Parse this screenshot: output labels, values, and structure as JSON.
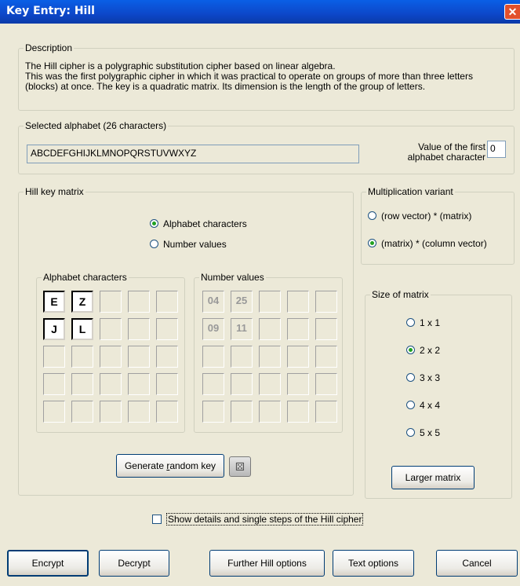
{
  "window": {
    "title": "Key Entry: Hill",
    "close_icon": "close-icon",
    "close_glyph": "✕"
  },
  "description": {
    "legend": "Description",
    "line1": "The Hill cipher is a polygraphic substitution cipher based on linear algebra.",
    "line2": "This was the first polygraphic cipher in which it was practical to operate on groups of more than three letters",
    "line3": "(blocks) at once. The key is a quadratic matrix. Its dimension is the length of the group of letters."
  },
  "alphabet": {
    "legend": "Selected alphabet (26 characters)",
    "value": "ABCDEFGHIJKLMNOPQRSTUVWXYZ",
    "first_label_1": "Value of the first",
    "first_label_2": "alphabet character",
    "first_value": "0"
  },
  "key_matrix": {
    "legend": "Hill key matrix",
    "mode_options": [
      "Alphabet characters",
      "Number values"
    ],
    "mode_selected": "Alphabet characters",
    "chars_legend": "Alphabet characters",
    "nums_legend": "Number values",
    "chars": [
      [
        "E",
        "Z"
      ],
      [
        "J",
        "L"
      ]
    ],
    "numbers": [
      [
        "04",
        "25"
      ],
      [
        "09",
        "11"
      ]
    ],
    "generate_label": "Generate random key",
    "generate_underline": "r",
    "dice_icon": "dice-icon"
  },
  "multiplication": {
    "legend": "Multiplication variant",
    "options": [
      "(row vector) * (matrix)",
      "(matrix) * (column vector)"
    ],
    "selected": "(matrix) * (column vector)"
  },
  "size": {
    "legend": "Size of matrix",
    "options": [
      "1 x 1",
      "2 x 2",
      "3 x 3",
      "4 x 4",
      "5 x 5"
    ],
    "selected": "2 x 2",
    "larger_label": "Larger matrix"
  },
  "show_details": {
    "label": "Show details and single steps of the Hill cipher",
    "checked": false
  },
  "buttons": {
    "encrypt": "Encrypt",
    "decrypt": "Decrypt",
    "further": "Further Hill options",
    "text_options": "Text options",
    "cancel": "Cancel"
  }
}
